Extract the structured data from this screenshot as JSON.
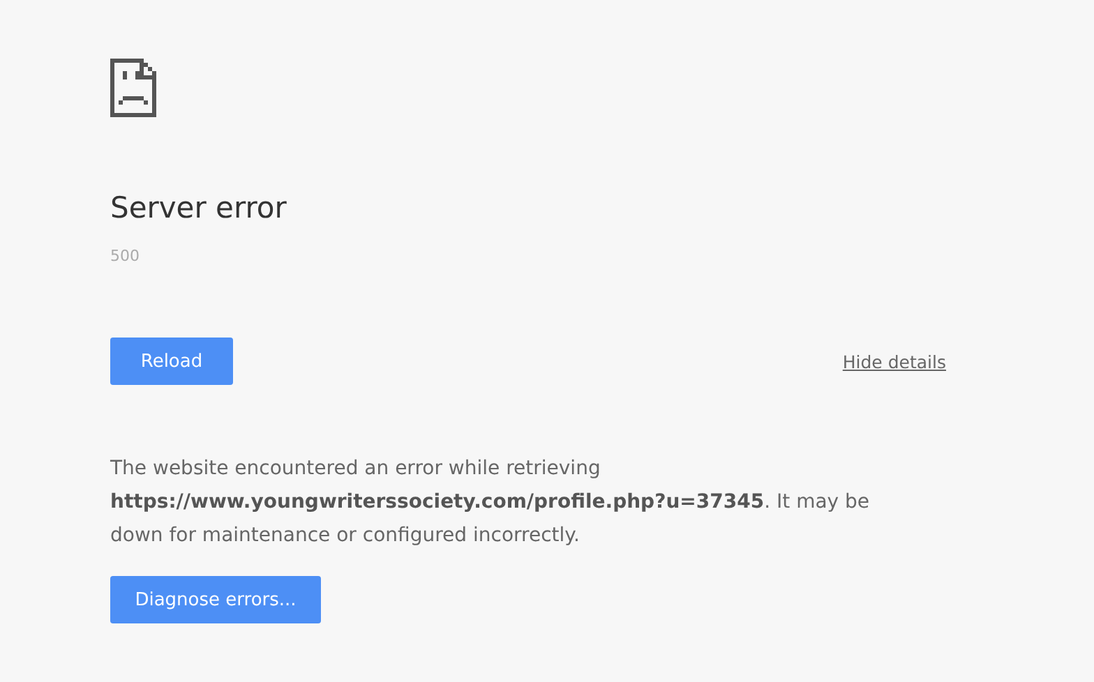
{
  "title": "Server error",
  "error_code": "500",
  "reload_button": "Reload",
  "details_link": "Hide details",
  "details_text": "The website encountered an error while retrieving **https://www.youngwriterssociety.com/profile.php?u=37345**. It may be down for maintenance or configured incorrectly.",
  "diagnose_button": "Diagnose errors..."
}
